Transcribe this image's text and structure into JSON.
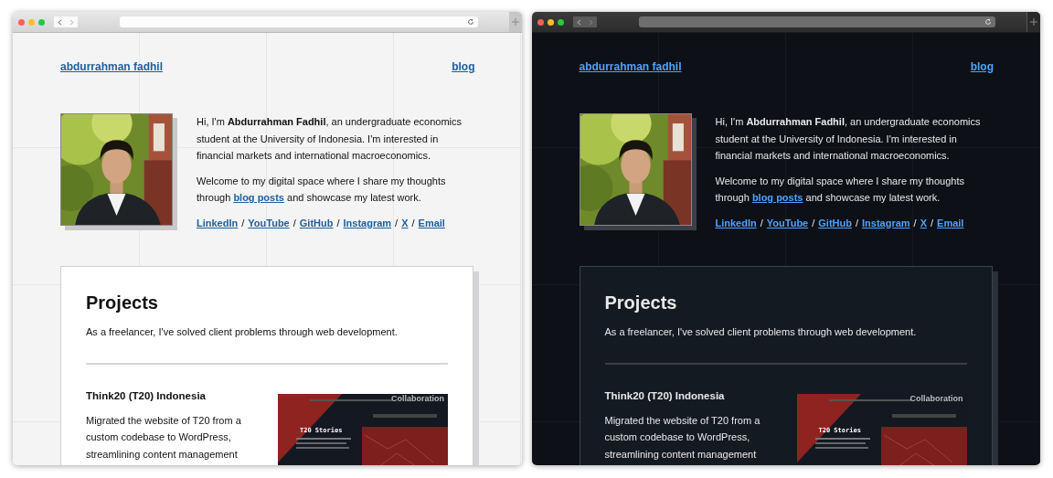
{
  "windows": [
    {
      "dark": false,
      "nav": {
        "home": "abdurrahman fadhil",
        "blog": "blog"
      },
      "intro": "Hi, I'm **Abdurrahman Fadhil**, an undergraduate economics student at the University of Indonesia. I'm interested in financial markets and international macroeconomics.",
      "welcome": {
        "before": "Welcome to my digital space where I share my thoughts through ",
        "link": "blog posts",
        "after": " and showcase my latest work."
      },
      "socials": [
        "LinkedIn",
        "YouTube",
        "GitHub",
        "Instagram",
        "X",
        "Email"
      ],
      "separator": "/",
      "projects": {
        "title": "Projects",
        "subtitle": "As a freelancer, I've solved client problems through web development.",
        "items": [
          {
            "title": "Think20 (T20) Indonesia",
            "description": "Migrated the website of T20 from a custom codebase to WordPress, streamlining content management",
            "screenshot": {
              "heading": "T20 Stories",
              "caption": "Collaboration"
            }
          }
        ]
      }
    },
    {
      "dark": true,
      "nav": {
        "home": "abdurrahman fadhil",
        "blog": "blog"
      },
      "intro": "Hi, I'm **Abdurrahman Fadhil**, an undergraduate economics student at the University of Indonesia. I'm interested in financial markets and international macroeconomics.",
      "welcome": {
        "before": "Welcome to my digital space where I share my thoughts through ",
        "link": "blog posts",
        "after": " and showcase my latest work."
      },
      "socials": [
        "LinkedIn",
        "YouTube",
        "GitHub",
        "Instagram",
        "X",
        "Email"
      ],
      "separator": "/",
      "projects": {
        "title": "Projects",
        "subtitle": "As a freelancer, I've solved client problems through web development.",
        "items": [
          {
            "title": "Think20 (T20) Indonesia",
            "description": "Migrated the website of T20 from a custom codebase to WordPress, streamlining content management",
            "screenshot": {
              "heading": "T20 Stories",
              "caption": "Collaboration"
            }
          }
        ]
      }
    }
  ]
}
